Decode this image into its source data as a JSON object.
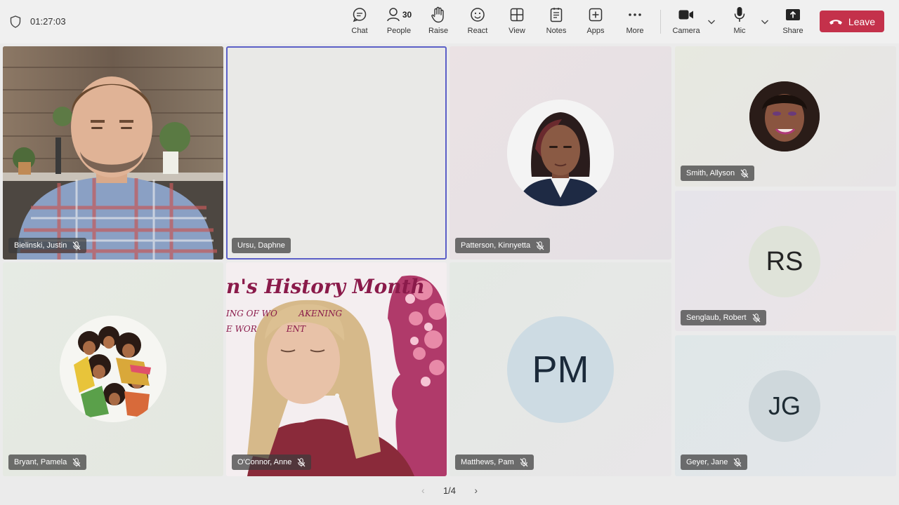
{
  "call": {
    "timer": "01:27:03"
  },
  "toolbar": {
    "chat": "Chat",
    "people": "People",
    "people_count": "30",
    "raise": "Raise",
    "react": "React",
    "view": "View",
    "notes": "Notes",
    "apps": "Apps",
    "more": "More",
    "camera": "Camera",
    "mic": "Mic",
    "share": "Share",
    "leave": "Leave"
  },
  "participants": [
    {
      "name": "Bielinski, Justin"
    },
    {
      "name": "Ursu, Daphne"
    },
    {
      "name": "Patterson, Kinnyetta"
    },
    {
      "name": "Smith, Allyson"
    },
    {
      "name": "Senglaub, Robert",
      "initials": "RS"
    },
    {
      "name": "Bryant, Pamela"
    },
    {
      "name": "O'Connor, Anne"
    },
    {
      "name": "Matthews, Pam",
      "initials": "PM"
    },
    {
      "name": "Geyer, Jane",
      "initials": "JG"
    }
  ],
  "background_banner": {
    "title": "n's History Month",
    "line1": "ING OF WO        AKENING",
    "line2": "E WOR           ENT"
  },
  "pagination": {
    "label": "1/4"
  },
  "colors": {
    "leave": "#c4314b",
    "active_speaker_border": "#5b5fc7"
  }
}
